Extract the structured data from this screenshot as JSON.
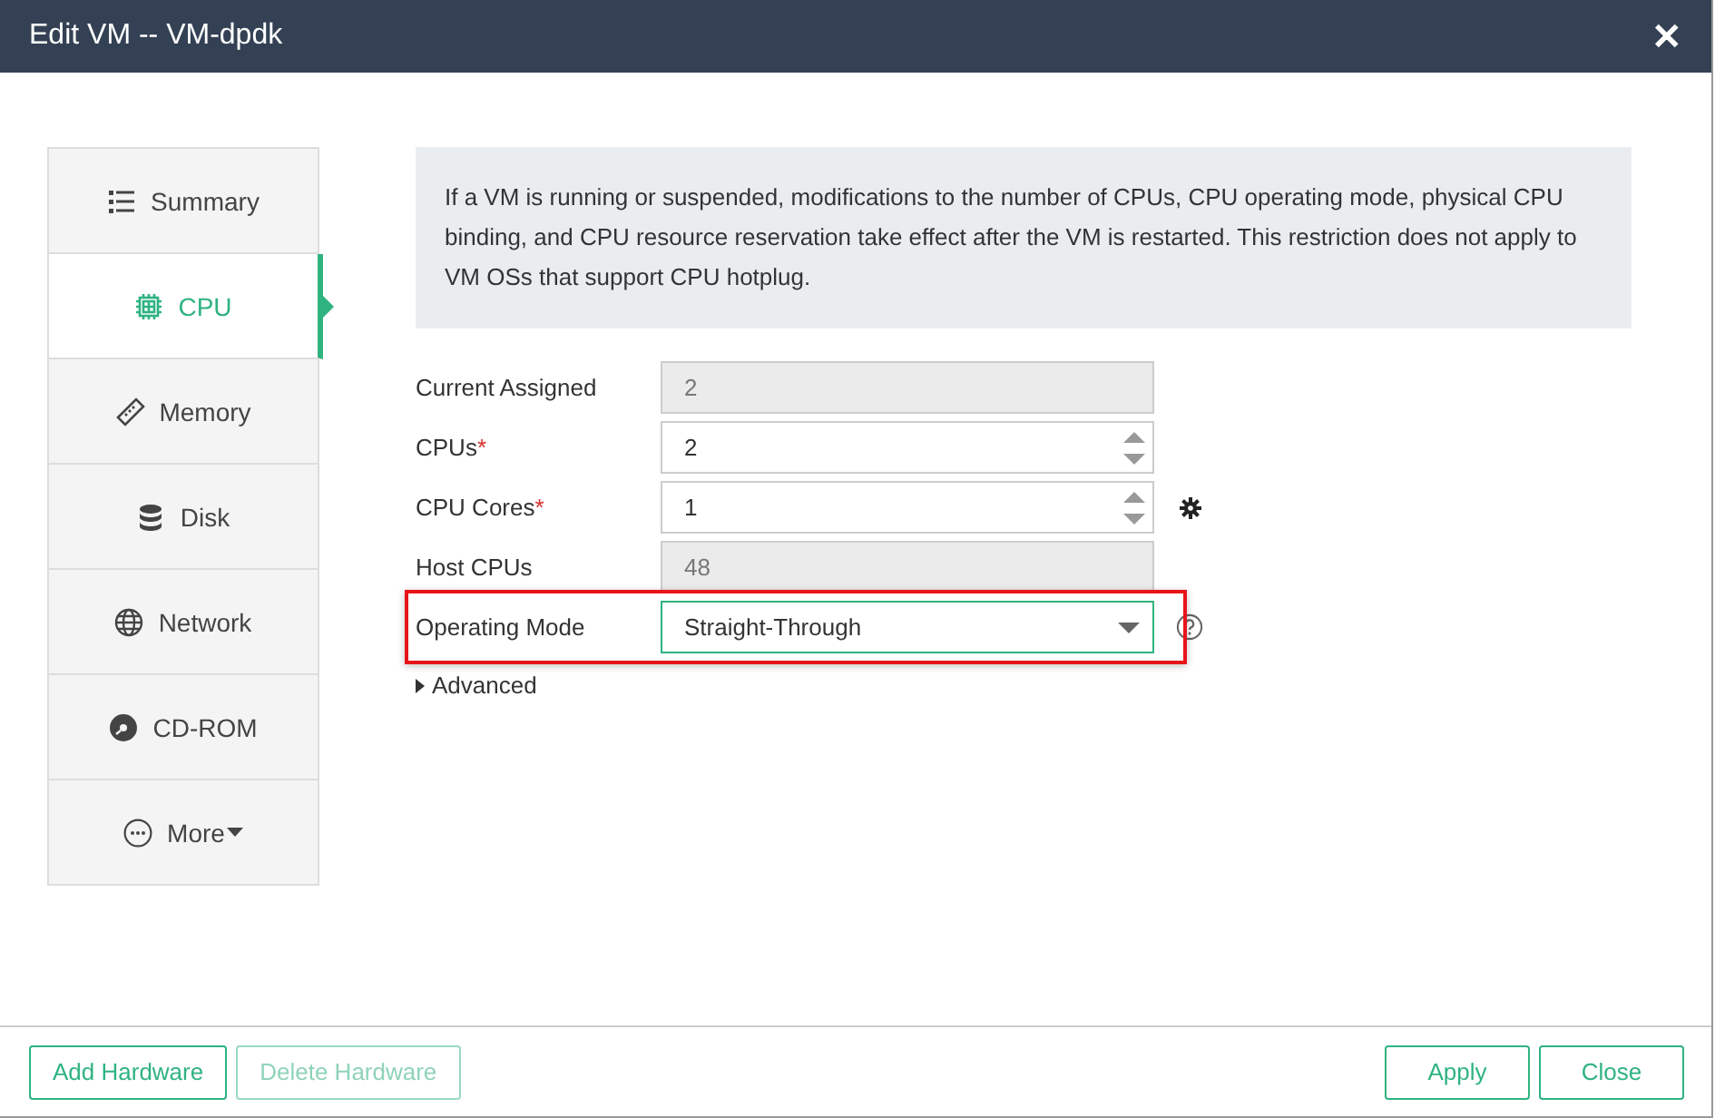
{
  "window": {
    "title": "Edit VM -- VM-dpdk",
    "close": "✕"
  },
  "sidebar": {
    "items": [
      {
        "label": "Summary",
        "selected": false
      },
      {
        "label": "CPU",
        "selected": true
      },
      {
        "label": "Memory",
        "selected": false
      },
      {
        "label": "Disk",
        "selected": false
      },
      {
        "label": "Network",
        "selected": false
      },
      {
        "label": "CD-ROM",
        "selected": false
      },
      {
        "label": "More",
        "selected": false,
        "dropdown": true
      }
    ]
  },
  "notice": "If a VM is running or suspended, modifications to the number of CPUs, CPU operating mode, physical CPU binding, and CPU resource reservation take effect after the VM is restarted. This restriction does not apply to VM OSs that support CPU hotplug.",
  "fields": [
    {
      "label": "Current Assigned",
      "kind": "readonly",
      "value": "2"
    },
    {
      "label": "CPUs",
      "kind": "spinner",
      "value": "2",
      "required_mark": "*"
    },
    {
      "label": "CPU Cores",
      "kind": "spinner",
      "value": "1",
      "required_mark": "*"
    },
    {
      "label": "Host CPUs",
      "kind": "readonly",
      "value": "48"
    },
    {
      "label": "Operating Mode",
      "kind": "select",
      "value": "Straight-Through",
      "highlighted": true
    }
  ],
  "advanced": {
    "label": "Advanced",
    "expanded": false
  },
  "footer": {
    "left": [
      {
        "label": "Add Hardware",
        "disabled": false
      },
      {
        "label": "Delete Hardware",
        "disabled": true
      }
    ],
    "right": [
      {
        "label": "Apply",
        "disabled": false
      },
      {
        "label": "Close",
        "disabled": false
      }
    ]
  }
}
